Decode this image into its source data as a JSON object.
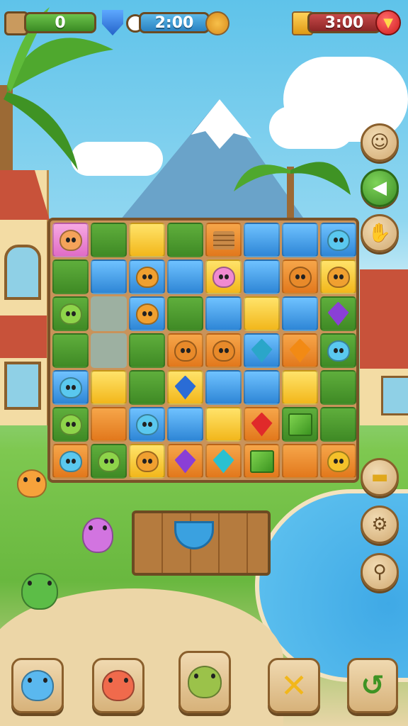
{
  "hud": {
    "score": "0",
    "timer_1": "2:00",
    "timer_2": "3:00"
  },
  "board": {
    "rows": [
      [
        "pink-critter",
        "green",
        "yellow",
        "green",
        "crate",
        "blue",
        "blue",
        "blue-critter"
      ],
      [
        "green",
        "blue",
        "bear-blue",
        "blue",
        "pink-critter-yellow",
        "blue",
        "bear-orange",
        "bear-yellow"
      ],
      [
        "green-critter",
        "empty",
        "bear-blue",
        "green",
        "blue",
        "yellow",
        "blue",
        "purple-gem"
      ],
      [
        "green",
        "empty",
        "green",
        "bear-orange",
        "bear-orange",
        "blue-gem",
        "orange-gem",
        "blue-critter-green"
      ],
      [
        "blue-critter",
        "yellow",
        "green",
        "blue-gem-yellow",
        "blue",
        "blue",
        "yellow",
        "green"
      ],
      [
        "green-critter",
        "orange",
        "blue-critter",
        "blue",
        "yellow",
        "red-gem",
        "green-cube",
        "green"
      ],
      [
        "blue-critter-orange",
        "green-critter-green",
        "bear-yellow",
        "purple-gem-orange",
        "teal-gem-orange",
        "green-cube-orange",
        "orange",
        "bear-gold"
      ]
    ]
  },
  "side_buttons": [
    "face-icon",
    "sound-icon",
    "hand-icon",
    "hat-icon",
    "gear-icon",
    "magnifier-icon"
  ],
  "bottom_buttons": [
    "blue-monster-icon",
    "red-monster-icon",
    "green-monster-icon",
    "cross-icon",
    "undo-icon"
  ]
}
